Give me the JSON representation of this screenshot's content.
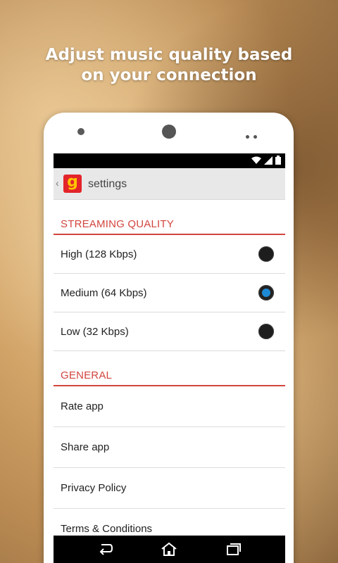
{
  "promo": {
    "headline_line1": "Adjust music quality based",
    "headline_line2": "on your connection"
  },
  "actionbar": {
    "back_icon": "chevron-left-icon",
    "logo_letter": "g",
    "title": "settings"
  },
  "status_icons": [
    "wifi-icon",
    "signal-icon",
    "battery-icon"
  ],
  "streaming_quality": {
    "header": "STREAMING QUALITY",
    "options": [
      {
        "label": "High (128 Kbps)",
        "selected": false
      },
      {
        "label": "Medium (64 Kbps)",
        "selected": true
      },
      {
        "label": "Low (32 Kbps)",
        "selected": false
      }
    ]
  },
  "general": {
    "header": "GENERAL",
    "items": [
      {
        "label": "Rate app"
      },
      {
        "label": "Share app"
      },
      {
        "label": "Privacy Policy"
      },
      {
        "label": "Terms & Conditions"
      }
    ]
  },
  "navbar": [
    "back-icon",
    "home-icon",
    "recents-icon"
  ],
  "colors": {
    "accent": "#d2453e",
    "radio_selected": "#1e8ad6",
    "logo_bg": "#e3242b",
    "logo_letter": "#ffc400"
  }
}
